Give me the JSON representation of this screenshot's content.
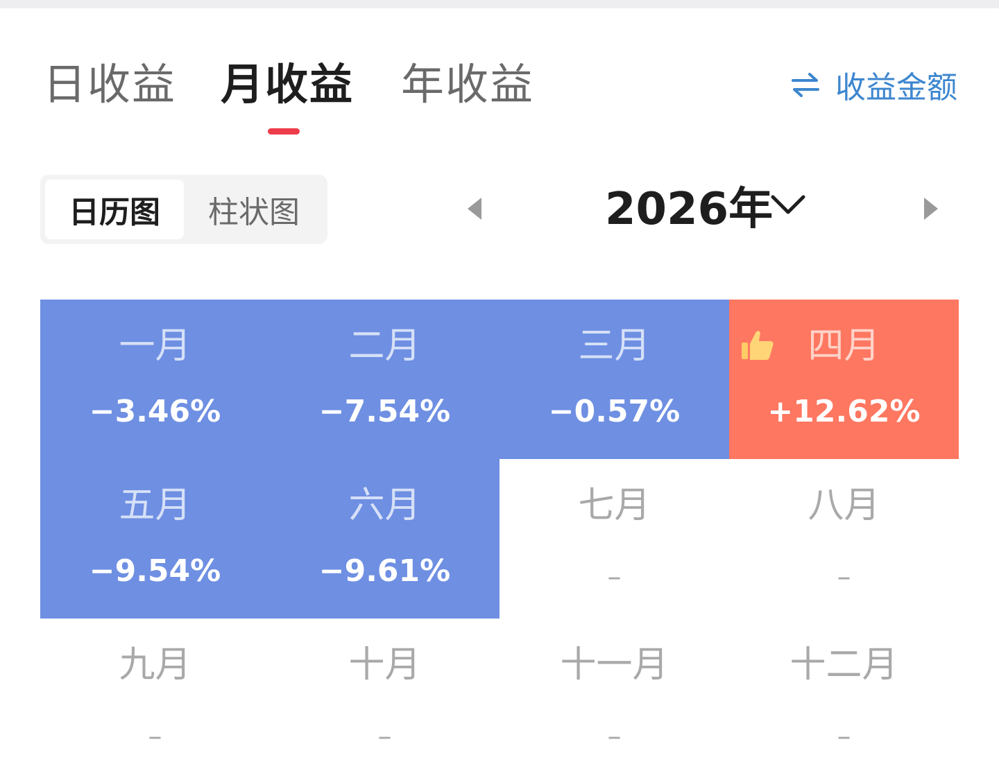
{
  "tabs": [
    {
      "label": "日收益",
      "active": false
    },
    {
      "label": "月收益",
      "active": true
    },
    {
      "label": "年收益",
      "active": false
    }
  ],
  "switch_amount_label": "收益金额",
  "view_toggle": {
    "calendar": "日历图",
    "bar": "柱状图",
    "selected": "日历图"
  },
  "year_label": "2026年",
  "colors": {
    "negative": "#6e8fe2",
    "positive": "#fe7761",
    "tab_indicator": "#ee3d4a",
    "link": "#3d86cf"
  },
  "months": [
    {
      "name": "一月",
      "value": "−3.46%",
      "state": "neg"
    },
    {
      "name": "二月",
      "value": "−7.54%",
      "state": "neg"
    },
    {
      "name": "三月",
      "value": "−0.57%",
      "state": "neg"
    },
    {
      "name": "四月",
      "value": "+12.62%",
      "state": "pos",
      "badge": "thumbs-up-icon"
    },
    {
      "name": "五月",
      "value": "−9.54%",
      "state": "neg"
    },
    {
      "name": "六月",
      "value": "−9.61%",
      "state": "neg"
    },
    {
      "name": "七月",
      "value": "–",
      "state": "empty"
    },
    {
      "name": "八月",
      "value": "–",
      "state": "empty"
    },
    {
      "name": "九月",
      "value": "–",
      "state": "empty"
    },
    {
      "name": "十月",
      "value": "–",
      "state": "empty"
    },
    {
      "name": "十一月",
      "value": "–",
      "state": "empty"
    },
    {
      "name": "十二月",
      "value": "–",
      "state": "empty"
    }
  ]
}
